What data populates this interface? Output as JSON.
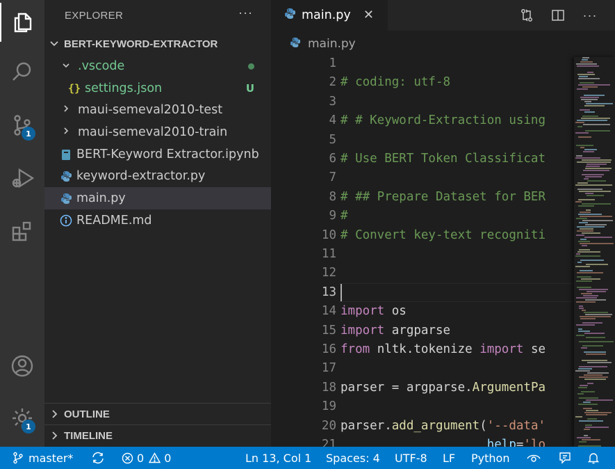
{
  "activity_bar": {
    "items": [
      {
        "icon": "files-icon",
        "active": true
      },
      {
        "icon": "search-icon"
      },
      {
        "icon": "source-control-icon",
        "badge": "1"
      },
      {
        "icon": "run-debug-icon"
      },
      {
        "icon": "extensions-icon"
      }
    ],
    "bottom": [
      {
        "icon": "account-icon"
      },
      {
        "icon": "settings-gear-icon",
        "badge": "1"
      }
    ]
  },
  "sidebar": {
    "title": "EXPLORER",
    "more": "···",
    "root_folder": "BERT-KEYWORD-EXTRACTOR",
    "tree": [
      {
        "label": ".vscode",
        "type": "folder",
        "expanded": true,
        "indent": 1,
        "color": "#73c991",
        "status": "dot"
      },
      {
        "label": "settings.json",
        "type": "json",
        "indent": 2,
        "color": "#73c991",
        "status": "U"
      },
      {
        "label": "maui-semeval2010-test",
        "type": "folder",
        "expanded": false,
        "indent": 1
      },
      {
        "label": "maui-semeval2010-train",
        "type": "folder",
        "expanded": false,
        "indent": 1
      },
      {
        "label": "BERT-Keyword Extractor.ipynb",
        "type": "notebook",
        "indent": 1
      },
      {
        "label": "keyword-extractor.py",
        "type": "python",
        "indent": 1
      },
      {
        "label": "main.py",
        "type": "python",
        "indent": 1,
        "selected": true
      },
      {
        "label": "README.md",
        "type": "info",
        "indent": 1
      }
    ],
    "outline_label": "OUTLINE",
    "timeline_label": "TIMELINE"
  },
  "editor": {
    "tab_label": "main.py",
    "tab_close": "✕",
    "breadcrumb_label": "main.py",
    "current_line": 13,
    "lines": [
      {
        "n": "1",
        "tokens": []
      },
      {
        "n": "2",
        "tokens": [
          [
            "cm",
            "# coding: utf-8"
          ]
        ]
      },
      {
        "n": "3",
        "tokens": []
      },
      {
        "n": "4",
        "tokens": [
          [
            "cm",
            "# # Keyword-Extraction using"
          ]
        ]
      },
      {
        "n": "5",
        "tokens": []
      },
      {
        "n": "6",
        "tokens": [
          [
            "cm",
            "# Use BERT Token Classificat"
          ]
        ]
      },
      {
        "n": "7",
        "tokens": []
      },
      {
        "n": "8",
        "tokens": [
          [
            "cm",
            "# ## Prepare Dataset for BER"
          ]
        ]
      },
      {
        "n": "9",
        "tokens": [
          [
            "cm",
            "#"
          ]
        ]
      },
      {
        "n": "10",
        "tokens": [
          [
            "cm",
            "# Convert key-text recogniti"
          ]
        ]
      },
      {
        "n": "11",
        "tokens": []
      },
      {
        "n": "12",
        "tokens": []
      },
      {
        "n": "13",
        "tokens": []
      },
      {
        "n": "14",
        "tokens": [
          [
            "kw",
            "import"
          ],
          [
            "",
            " os"
          ]
        ]
      },
      {
        "n": "15",
        "tokens": [
          [
            "kw",
            "import"
          ],
          [
            "",
            " argparse"
          ]
        ]
      },
      {
        "n": "16",
        "tokens": [
          [
            "kw",
            "from"
          ],
          [
            "",
            " nltk.tokenize "
          ],
          [
            "kw",
            "import"
          ],
          [
            "",
            " se"
          ]
        ]
      },
      {
        "n": "17",
        "tokens": []
      },
      {
        "n": "18",
        "tokens": [
          [
            "",
            "parser = argparse."
          ],
          [
            "fn",
            "ArgumentPa"
          ]
        ]
      },
      {
        "n": "19",
        "tokens": []
      },
      {
        "n": "20",
        "tokens": [
          [
            "",
            "parser."
          ],
          [
            "fn",
            "add_argument"
          ],
          [
            "",
            "("
          ],
          [
            "st",
            "'--data'"
          ]
        ]
      },
      {
        "n": "21",
        "tokens": [
          [
            "",
            "                    "
          ],
          [
            "pm",
            "help"
          ],
          [
            "",
            "="
          ],
          [
            "st",
            "'lo"
          ]
        ]
      }
    ]
  },
  "statusbar": {
    "branch": "master*",
    "errors": "0",
    "warnings": "0",
    "position": "Ln 13, Col 1",
    "spaces": "Spaces: 4",
    "encoding": "UTF-8",
    "eol": "LF",
    "language": "Python"
  },
  "colors": {
    "accent": "#007acc",
    "git_untracked": "#73c991"
  }
}
